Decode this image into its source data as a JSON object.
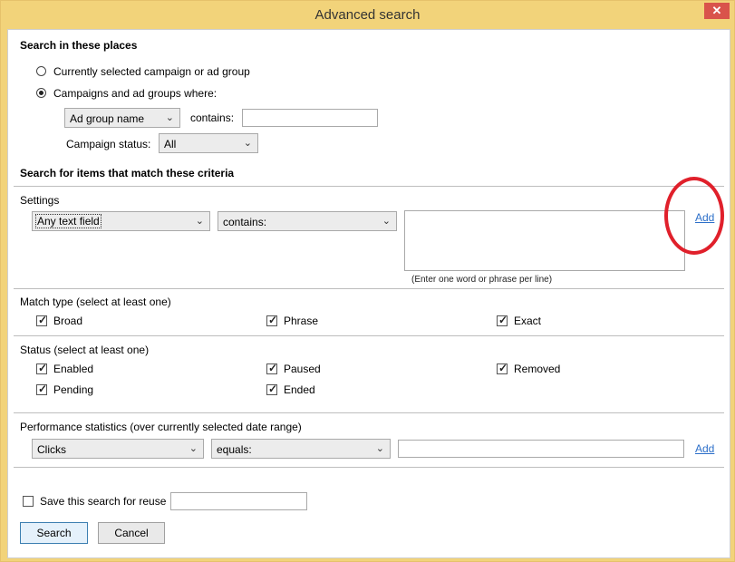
{
  "window": {
    "title": "Advanced search",
    "close_label": "✕"
  },
  "places": {
    "header": "Search in these places",
    "radio_current": "Currently selected campaign or ad group",
    "radio_where": "Campaigns and ad groups where:",
    "field_select": "Ad group name",
    "contains_label": "contains:",
    "contains_value": "",
    "campaign_status_label": "Campaign status:",
    "campaign_status_value": "All"
  },
  "criteria": {
    "header": "Search for items that match these criteria"
  },
  "settings": {
    "label": "Settings",
    "field_select": "Any text field",
    "operator_select": "contains:",
    "add_link": "Add",
    "hint": "(Enter one word or phrase per line)"
  },
  "match_type": {
    "label": "Match type (select at least one)",
    "options": [
      {
        "label": "Broad",
        "checked": true
      },
      {
        "label": "Phrase",
        "checked": true
      },
      {
        "label": "Exact",
        "checked": true
      }
    ]
  },
  "status": {
    "label": "Status (select at least one)",
    "options": [
      {
        "label": "Enabled",
        "checked": true
      },
      {
        "label": "Paused",
        "checked": true
      },
      {
        "label": "Removed",
        "checked": true
      },
      {
        "label": "Pending",
        "checked": true
      },
      {
        "label": "Ended",
        "checked": true
      }
    ]
  },
  "performance": {
    "label": "Performance statistics (over currently selected date range)",
    "metric_select": "Clicks",
    "operator_select": "equals:",
    "value": "",
    "add_link": "Add"
  },
  "save": {
    "label": "Save this search for reuse",
    "checked": false,
    "name_value": ""
  },
  "buttons": {
    "search": "Search",
    "cancel": "Cancel"
  },
  "icons": {
    "dropdown": "chevron-down-icon",
    "check": "checkmark-icon"
  },
  "colors": {
    "title_bar": "#f2d37a",
    "link": "#2c6fc9",
    "annotation_circle": "#e0202b"
  }
}
